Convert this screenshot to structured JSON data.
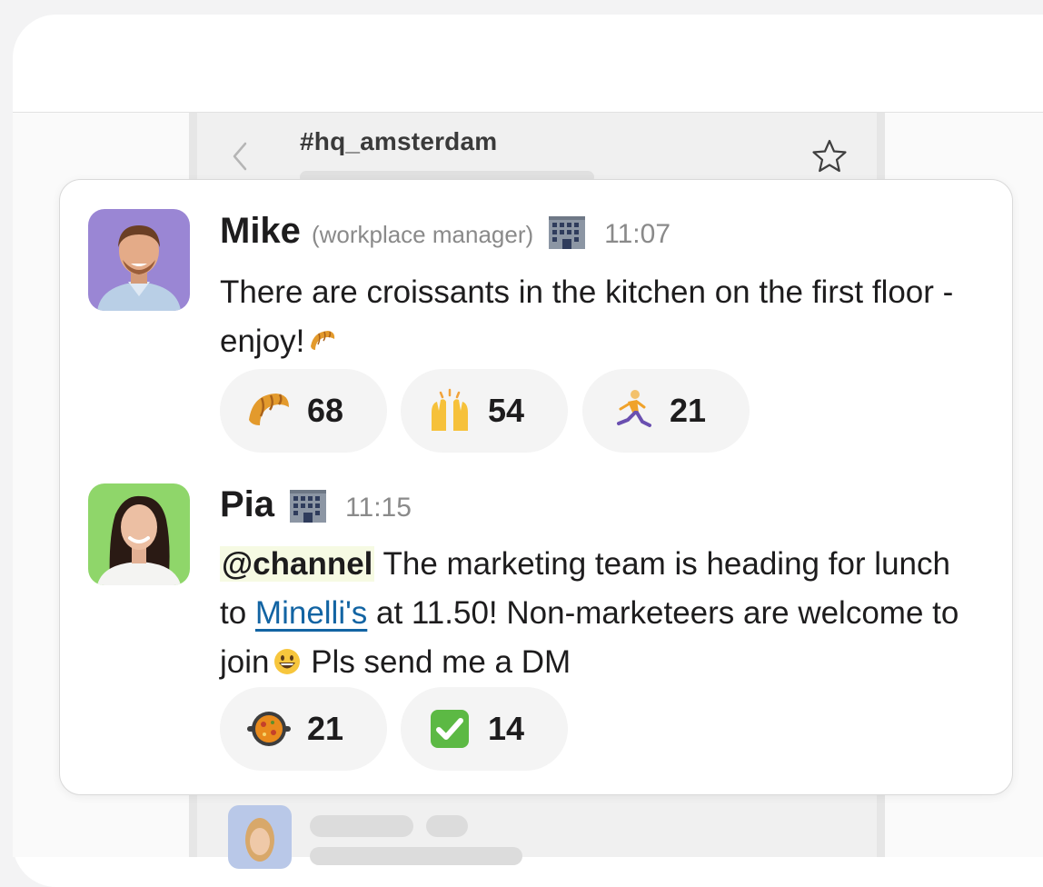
{
  "channel": {
    "name": "#hq_amsterdam"
  },
  "messages": [
    {
      "author": "Mike",
      "role": "(workplace manager)",
      "status_icon": "office-building-icon",
      "time": "11:07",
      "text": "There are croissants in the kitchen on the first floor - enjoy!",
      "inline_emoji": "croissant-icon",
      "reactions": [
        {
          "emoji": "croissant-icon",
          "count": "68"
        },
        {
          "emoji": "raised-hands-icon",
          "count": "54"
        },
        {
          "emoji": "running-person-icon",
          "count": "21"
        }
      ]
    },
    {
      "author": "Pia",
      "status_icon": "office-building-icon",
      "time": "11:15",
      "mention": "@channel",
      "text_before_link": " The marketing team is heading for lunch to ",
      "link_text": "Minelli's",
      "text_after_link": " at 11.50! Non-marketeers are welcome to join",
      "inline_emoji": "grinning-face-icon",
      "text_end": " Pls send me a DM",
      "reactions": [
        {
          "emoji": "paella-pan-icon",
          "count": "21"
        },
        {
          "emoji": "check-mark-button-icon",
          "count": "14"
        }
      ]
    }
  ],
  "colors": {
    "link": "#1264a3",
    "mention_bg": "#f6fae3",
    "mike_avatar_bg": "#9a86d4",
    "pia_avatar_bg": "#8fd66a"
  }
}
